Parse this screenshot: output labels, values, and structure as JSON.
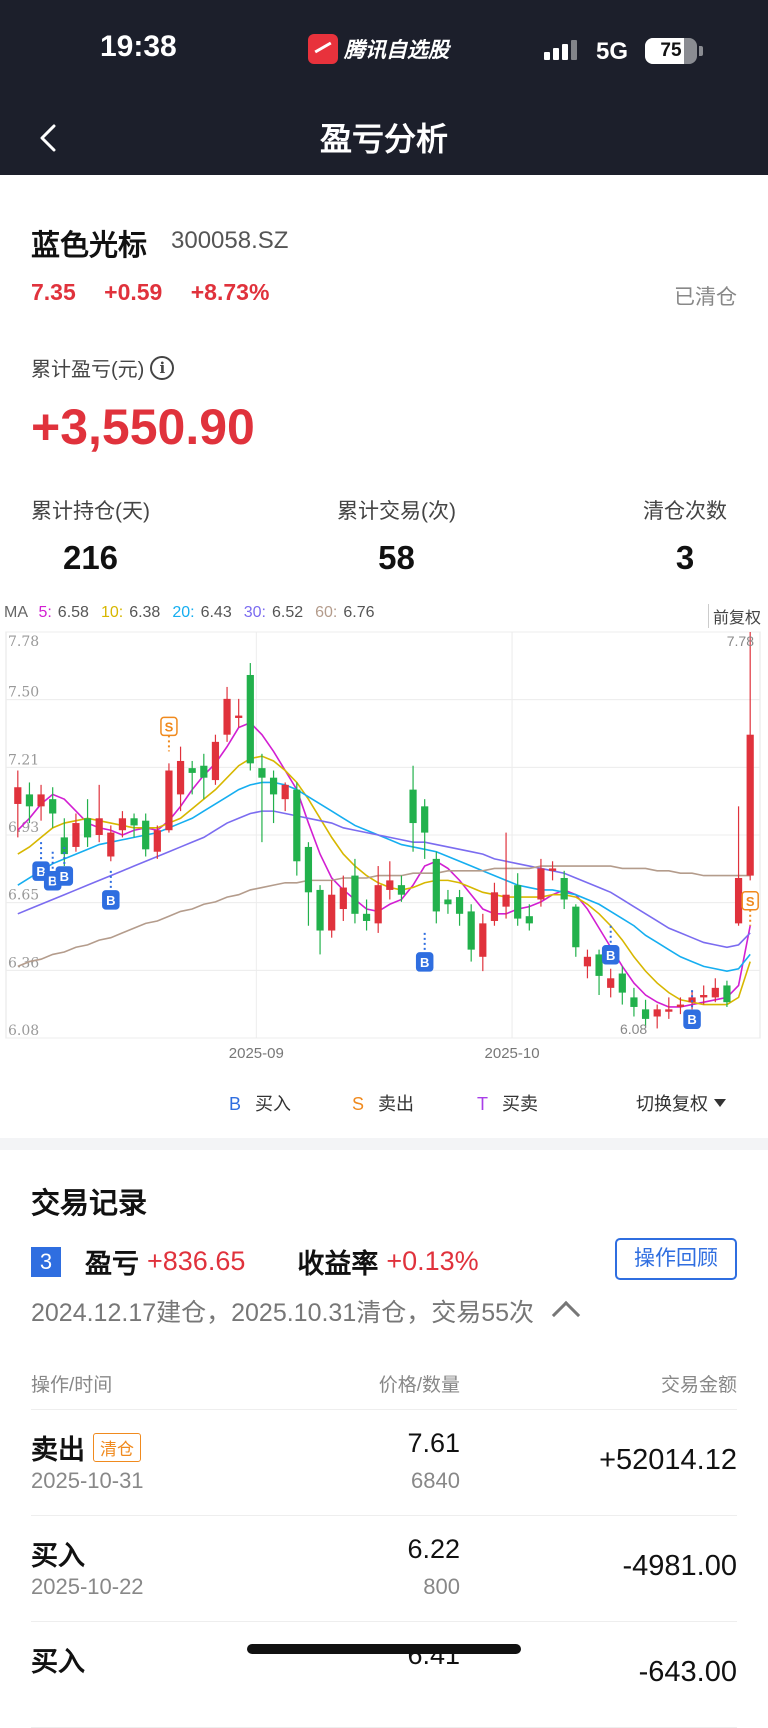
{
  "status": {
    "time": "19:38",
    "app_name": "腾讯自选股",
    "network": "5G",
    "battery": "75",
    "battery_level": 0.75
  },
  "nav": {
    "title": "盈亏分析"
  },
  "stock": {
    "name": "蓝色光标",
    "code": "300058.SZ",
    "price": "7.35",
    "change": "+0.59",
    "change_pct": "+8.73%",
    "status": "已清仓"
  },
  "cumulative": {
    "label": "累计盈亏(元)",
    "value": "+3,550.90"
  },
  "stats": [
    {
      "label": "累计持仓(天)",
      "value": "216"
    },
    {
      "label": "累计交易(次)",
      "value": "58"
    },
    {
      "label": "清仓次数",
      "value": "3"
    }
  ],
  "ma": {
    "prefix": "MA",
    "items": [
      {
        "label": "5:",
        "value": "6.58",
        "color": "#d21fd2"
      },
      {
        "label": "10:",
        "value": "6.38",
        "color": "#d7b700"
      },
      {
        "label": "20:",
        "value": "6.43",
        "color": "#16aef0"
      },
      {
        "label": "30:",
        "value": "6.52",
        "color": "#7b6cf0"
      },
      {
        "label": "60:",
        "value": "6.76",
        "color": "#b49c8c"
      }
    ],
    "adjust_label": "前复权"
  },
  "chart_data": {
    "type": "candlestick",
    "y_ticks": [
      "7.78",
      "7.50",
      "7.21",
      "6.93",
      "6.65",
      "6.36",
      "6.08"
    ],
    "y_range": [
      6.08,
      7.78
    ],
    "x_ticks": [
      "2025-09",
      "2025-10"
    ],
    "max_label": "7.78",
    "min_label": "6.08",
    "up_color": "#e0323c",
    "down_color": "#22b14c",
    "candles": [
      {
        "o": 7.06,
        "c": 7.13,
        "h": 7.2,
        "l": 6.92
      },
      {
        "o": 7.1,
        "c": 7.05,
        "h": 7.15,
        "l": 6.98
      },
      {
        "o": 7.05,
        "c": 7.1,
        "h": 7.14,
        "l": 6.99
      },
      {
        "o": 7.08,
        "c": 7.02,
        "h": 7.13,
        "l": 6.96
      },
      {
        "o": 6.92,
        "c": 6.85,
        "h": 7.0,
        "l": 6.8
      },
      {
        "o": 6.88,
        "c": 6.98,
        "h": 7.02,
        "l": 6.86
      },
      {
        "o": 7.0,
        "c": 6.92,
        "h": 7.08,
        "l": 6.88
      },
      {
        "o": 6.93,
        "c": 7.0,
        "h": 7.14,
        "l": 6.9
      },
      {
        "o": 6.84,
        "c": 6.94,
        "h": 6.97,
        "l": 6.82
      },
      {
        "o": 6.95,
        "c": 7.0,
        "h": 7.03,
        "l": 6.92
      },
      {
        "o": 7.0,
        "c": 6.97,
        "h": 7.02,
        "l": 6.92
      },
      {
        "o": 6.99,
        "c": 6.87,
        "h": 7.02,
        "l": 6.84
      },
      {
        "o": 6.86,
        "c": 6.95,
        "h": 6.97,
        "l": 6.83
      },
      {
        "o": 6.95,
        "c": 7.2,
        "h": 7.23,
        "l": 6.94
      },
      {
        "o": 7.1,
        "c": 7.24,
        "h": 7.3,
        "l": 7.03
      },
      {
        "o": 7.21,
        "c": 7.19,
        "h": 7.24,
        "l": 7.1
      },
      {
        "o": 7.22,
        "c": 7.17,
        "h": 7.27,
        "l": 7.08
      },
      {
        "o": 7.16,
        "c": 7.32,
        "h": 7.35,
        "l": 7.14
      },
      {
        "o": 7.35,
        "c": 7.5,
        "h": 7.55,
        "l": 7.32
      },
      {
        "o": 7.42,
        "c": 7.43,
        "h": 7.5,
        "l": 7.38
      },
      {
        "o": 7.6,
        "c": 7.23,
        "h": 7.65,
        "l": 7.2
      },
      {
        "o": 7.21,
        "c": 7.17,
        "h": 7.27,
        "l": 6.9
      },
      {
        "o": 7.17,
        "c": 7.1,
        "h": 7.2,
        "l": 6.98
      },
      {
        "o": 7.08,
        "c": 7.14,
        "h": 7.15,
        "l": 7.03
      },
      {
        "o": 7.12,
        "c": 6.82,
        "h": 7.15,
        "l": 6.76
      },
      {
        "o": 6.88,
        "c": 6.69,
        "h": 6.9,
        "l": 6.55
      },
      {
        "o": 6.7,
        "c": 6.53,
        "h": 6.72,
        "l": 6.43
      },
      {
        "o": 6.53,
        "c": 6.68,
        "h": 6.74,
        "l": 6.5
      },
      {
        "o": 6.62,
        "c": 6.71,
        "h": 6.76,
        "l": 6.57
      },
      {
        "o": 6.76,
        "c": 6.6,
        "h": 6.83,
        "l": 6.56
      },
      {
        "o": 6.6,
        "c": 6.57,
        "h": 6.66,
        "l": 6.53
      },
      {
        "o": 6.56,
        "c": 6.72,
        "h": 6.8,
        "l": 6.52
      },
      {
        "o": 6.7,
        "c": 6.74,
        "h": 6.82,
        "l": 6.66
      },
      {
        "o": 6.72,
        "c": 6.68,
        "h": 6.76,
        "l": 6.65
      },
      {
        "o": 7.12,
        "c": 6.98,
        "h": 7.22,
        "l": 6.86
      },
      {
        "o": 7.05,
        "c": 6.94,
        "h": 7.08,
        "l": 6.83
      },
      {
        "o": 6.83,
        "c": 6.61,
        "h": 6.86,
        "l": 6.56
      },
      {
        "o": 6.66,
        "c": 6.64,
        "h": 6.7,
        "l": 6.6
      },
      {
        "o": 6.67,
        "c": 6.6,
        "h": 6.7,
        "l": 6.55
      },
      {
        "o": 6.61,
        "c": 6.45,
        "h": 6.64,
        "l": 6.4
      },
      {
        "o": 6.42,
        "c": 6.56,
        "h": 6.6,
        "l": 6.36
      },
      {
        "o": 6.57,
        "c": 6.69,
        "h": 6.73,
        "l": 6.55
      },
      {
        "o": 6.63,
        "c": 6.68,
        "h": 6.94,
        "l": 6.58
      },
      {
        "o": 6.72,
        "c": 6.58,
        "h": 6.77,
        "l": 6.55
      },
      {
        "o": 6.59,
        "c": 6.56,
        "h": 6.64,
        "l": 6.53
      },
      {
        "o": 6.66,
        "c": 6.79,
        "h": 6.83,
        "l": 6.63
      },
      {
        "o": 6.78,
        "c": 6.79,
        "h": 6.82,
        "l": 6.74
      },
      {
        "o": 6.75,
        "c": 6.66,
        "h": 6.78,
        "l": 6.62
      },
      {
        "o": 6.63,
        "c": 6.46,
        "h": 6.64,
        "l": 6.42
      },
      {
        "o": 6.38,
        "c": 6.42,
        "h": 6.45,
        "l": 6.33
      },
      {
        "o": 6.43,
        "c": 6.34,
        "h": 6.45,
        "l": 6.26
      },
      {
        "o": 6.29,
        "c": 6.33,
        "h": 6.37,
        "l": 6.25
      },
      {
        "o": 6.35,
        "c": 6.27,
        "h": 6.38,
        "l": 6.22
      },
      {
        "o": 6.25,
        "c": 6.21,
        "h": 6.29,
        "l": 6.17
      },
      {
        "o": 6.2,
        "c": 6.16,
        "h": 6.24,
        "l": 6.13
      },
      {
        "o": 6.17,
        "c": 6.2,
        "h": 6.22,
        "l": 6.12
      },
      {
        "o": 6.19,
        "c": 6.2,
        "h": 6.25,
        "l": 6.16
      },
      {
        "o": 6.21,
        "c": 6.22,
        "h": 6.25,
        "l": 6.18
      },
      {
        "o": 6.23,
        "c": 6.25,
        "h": 6.28,
        "l": 6.2
      },
      {
        "o": 6.25,
        "c": 6.26,
        "h": 6.3,
        "l": 6.22
      },
      {
        "o": 6.25,
        "c": 6.29,
        "h": 6.33,
        "l": 6.23
      },
      {
        "o": 6.3,
        "c": 6.23,
        "h": 6.32,
        "l": 6.21
      },
      {
        "o": 6.56,
        "c": 6.75,
        "h": 7.05,
        "l": 6.55
      },
      {
        "o": 6.76,
        "c": 7.35,
        "h": 7.78,
        "l": 6.74
      }
    ],
    "ma_series": [
      {
        "name": "MA5",
        "color": "#d21fd2",
        "values": [
          6.95,
          7.0,
          7.06,
          7.1,
          7.08,
          7.03,
          6.98,
          6.96,
          6.95,
          6.93,
          6.95,
          6.96,
          6.95,
          6.99,
          7.05,
          7.12,
          7.18,
          7.23,
          7.3,
          7.38,
          7.4,
          7.35,
          7.28,
          7.2,
          7.12,
          6.98,
          6.85,
          6.75,
          6.7,
          6.66,
          6.62,
          6.61,
          6.64,
          6.66,
          6.72,
          6.8,
          6.82,
          6.79,
          6.74,
          6.68,
          6.62,
          6.6,
          6.6,
          6.62,
          6.63,
          6.65,
          6.68,
          6.7,
          6.68,
          6.62,
          6.54,
          6.46,
          6.38,
          6.31,
          6.26,
          6.23,
          6.21,
          6.21,
          6.22,
          6.23,
          6.24,
          6.25,
          6.3,
          6.55
        ]
      },
      {
        "name": "MA10",
        "color": "#d7b700",
        "values": [
          6.85,
          6.88,
          6.92,
          6.96,
          6.98,
          6.99,
          7.0,
          6.99,
          6.98,
          6.97,
          6.96,
          6.96,
          6.96,
          6.98,
          7.0,
          7.04,
          7.08,
          7.12,
          7.17,
          7.22,
          7.25,
          7.26,
          7.24,
          7.2,
          7.15,
          7.08,
          7.0,
          6.92,
          6.85,
          6.8,
          6.76,
          6.73,
          6.71,
          6.7,
          6.71,
          6.73,
          6.74,
          6.74,
          6.73,
          6.71,
          6.69,
          6.68,
          6.67,
          6.67,
          6.67,
          6.67,
          6.68,
          6.68,
          6.67,
          6.64,
          6.6,
          6.55,
          6.49,
          6.42,
          6.36,
          6.31,
          6.27,
          6.24,
          6.23,
          6.22,
          6.22,
          6.22,
          6.25,
          6.4
        ]
      },
      {
        "name": "MA20",
        "color": "#16aef0",
        "values": [
          6.72,
          6.75,
          6.78,
          6.81,
          6.83,
          6.85,
          6.87,
          6.89,
          6.9,
          6.91,
          6.92,
          6.93,
          6.94,
          6.96,
          6.98,
          7.0,
          7.03,
          7.06,
          7.09,
          7.12,
          7.14,
          7.15,
          7.15,
          7.14,
          7.12,
          7.09,
          7.06,
          7.03,
          7.0,
          6.97,
          6.95,
          6.93,
          6.91,
          6.89,
          6.88,
          6.87,
          6.86,
          6.84,
          6.82,
          6.8,
          6.78,
          6.76,
          6.74,
          6.72,
          6.71,
          6.7,
          6.7,
          6.69,
          6.68,
          6.66,
          6.64,
          6.61,
          6.58,
          6.55,
          6.51,
          6.48,
          6.45,
          6.42,
          6.4,
          6.38,
          6.37,
          6.36,
          6.37,
          6.43
        ]
      },
      {
        "name": "MA30",
        "color": "#7b6cf0",
        "values": [
          6.6,
          6.62,
          6.64,
          6.66,
          6.68,
          6.7,
          6.72,
          6.74,
          6.76,
          6.78,
          6.8,
          6.82,
          6.84,
          6.86,
          6.88,
          6.9,
          6.92,
          6.95,
          6.98,
          7.0,
          7.02,
          7.03,
          7.03,
          7.02,
          7.01,
          7.0,
          6.99,
          6.98,
          6.96,
          6.95,
          6.94,
          6.93,
          6.92,
          6.91,
          6.9,
          6.9,
          6.89,
          6.88,
          6.87,
          6.86,
          6.85,
          6.83,
          6.82,
          6.81,
          6.8,
          6.79,
          6.78,
          6.77,
          6.75,
          6.73,
          6.71,
          6.69,
          6.66,
          6.63,
          6.6,
          6.57,
          6.54,
          6.52,
          6.5,
          6.48,
          6.47,
          6.46,
          6.47,
          6.52
        ]
      },
      {
        "name": "MA60",
        "color": "#b49c8c",
        "values": [
          6.38,
          6.4,
          6.41,
          6.43,
          6.44,
          6.46,
          6.47,
          6.49,
          6.5,
          6.52,
          6.54,
          6.56,
          6.57,
          6.59,
          6.61,
          6.62,
          6.64,
          6.65,
          6.67,
          6.68,
          6.7,
          6.71,
          6.72,
          6.73,
          6.73,
          6.74,
          6.74,
          6.74,
          6.75,
          6.75,
          6.75,
          6.76,
          6.76,
          6.76,
          6.77,
          6.77,
          6.77,
          6.78,
          6.78,
          6.78,
          6.78,
          6.79,
          6.79,
          6.79,
          6.79,
          6.8,
          6.8,
          6.8,
          6.8,
          6.8,
          6.8,
          6.8,
          6.79,
          6.79,
          6.79,
          6.78,
          6.78,
          6.77,
          6.77,
          6.76,
          6.76,
          6.76,
          6.76,
          6.76
        ]
      }
    ],
    "markers": [
      {
        "label": "B",
        "index": 2,
        "price": 6.9,
        "color": "#2f6ee0"
      },
      {
        "label": "B",
        "index": 3,
        "price": 6.86,
        "color": "#2f6ee0"
      },
      {
        "label": "B",
        "index": 4,
        "price": 6.88,
        "color": "#2f6ee0"
      },
      {
        "label": "B",
        "index": 8,
        "price": 6.78,
        "color": "#2f6ee0"
      },
      {
        "label": "S",
        "index": 13,
        "price": 7.28,
        "color": "#f08a1e"
      },
      {
        "label": "B",
        "index": 35,
        "price": 6.52,
        "color": "#2f6ee0"
      },
      {
        "label": "B",
        "index": 51,
        "price": 6.55,
        "color": "#2f6ee0"
      },
      {
        "label": "B",
        "index": 58,
        "price": 6.28,
        "color": "#2f6ee0"
      },
      {
        "label": "S",
        "index": 63,
        "price": 6.55,
        "color": "#f08a1e"
      }
    ]
  },
  "legend": {
    "buy": {
      "letter": "B",
      "label": "买入",
      "color": "#2f6ee0"
    },
    "sell": {
      "letter": "S",
      "label": "卖出",
      "color": "#f08a1e"
    },
    "both": {
      "letter": "T",
      "label": "买卖",
      "color": "#a83ee8"
    },
    "switch_label": "切换复权"
  },
  "trades": {
    "title": "交易记录",
    "number": "3",
    "pnl_label": "盈亏",
    "pnl_value": "+836.65",
    "return_label": "收益率",
    "return_value": "+0.13%",
    "review_button": "操作回顾",
    "period": "2024.12.17建仓，2025.10.31清仓，交易55次",
    "headers": {
      "action": "操作/时间",
      "price": "价格/数量",
      "amount": "交易金额"
    },
    "rows": [
      {
        "action": "卖出",
        "tag": "清仓",
        "date": "2025-10-31",
        "price": "7.61",
        "qty": "6840",
        "amount": "+52014.12"
      },
      {
        "action": "买入",
        "tag": "",
        "date": "2025-10-22",
        "price": "6.22",
        "qty": "800",
        "amount": "-4981.00"
      },
      {
        "action": "买入",
        "tag": "",
        "date": "",
        "price": "6.41",
        "qty": "",
        "amount": "-643.00"
      }
    ]
  }
}
